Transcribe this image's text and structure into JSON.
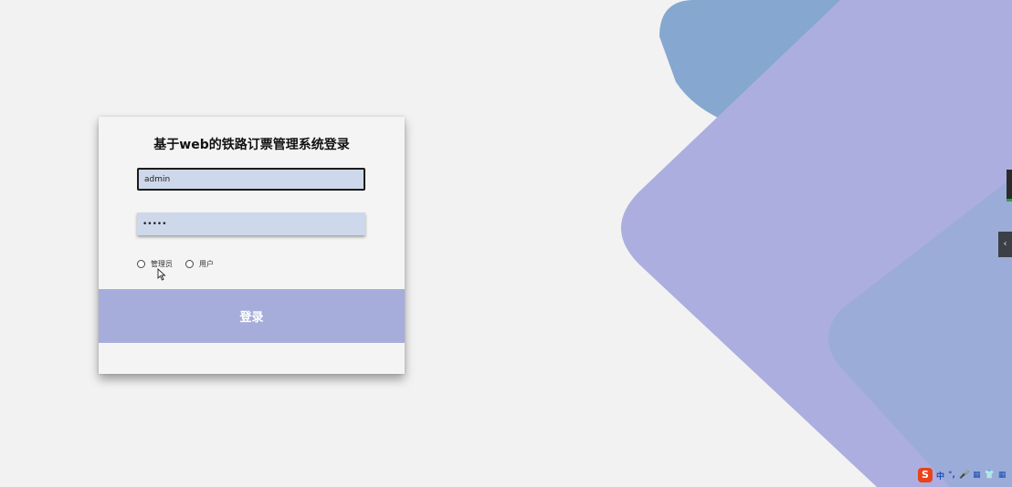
{
  "login": {
    "title": "基于web的铁路订票管理系统登录",
    "username_value": "admin",
    "password_value": "•••••",
    "roles": [
      {
        "label": "管理员",
        "selected": false
      },
      {
        "label": "用户",
        "selected": false
      }
    ],
    "submit_label": "登录"
  },
  "side_handle": {
    "icon": "chevron-left-icon",
    "glyph": "‹"
  },
  "ime": {
    "logo": "S",
    "items": [
      "中",
      "°,",
      "🎤",
      "▦",
      "👕",
      "▦"
    ],
    "icons": [
      "ime-mode-icon",
      "punctuation-icon",
      "microphone-icon",
      "keyboard-icon",
      "skin-icon",
      "grid-icon"
    ]
  },
  "colors": {
    "background": "#f2f2f2",
    "field_bg": "#cdd8ea",
    "button_bg": "#a7addb",
    "shape_blue": "#86a7cf",
    "shape_purple": "#acaee0"
  }
}
